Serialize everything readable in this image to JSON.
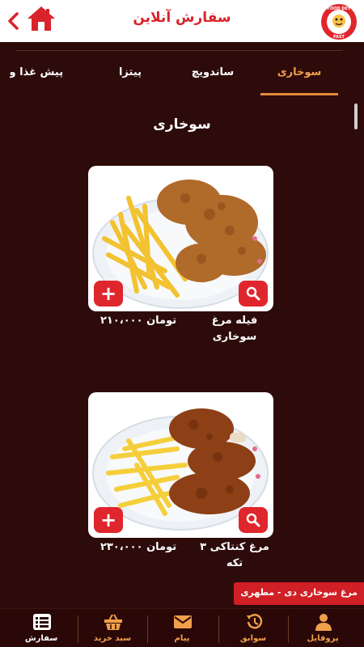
{
  "header": {
    "title": "سفارش آنلاین",
    "back_icon": "chevron-left-icon",
    "home_icon": "home-icon",
    "logo_text": "FOOD DEY FAST",
    "accent": "#d9232a"
  },
  "tabs": [
    {
      "label": "سوخاری",
      "active": true
    },
    {
      "label": "ساندویچ",
      "active": false
    },
    {
      "label": "پیتزا",
      "active": false
    },
    {
      "label": "پیش غذا و نو",
      "active": false
    }
  ],
  "section_title": "سوخاری",
  "products": [
    {
      "name_line1": "فیله مرغ",
      "name_line2": "سوخاری",
      "price": "۲۱۰،۰۰۰ تومان",
      "add_icon": "plus-icon",
      "zoom_icon": "search-icon"
    },
    {
      "name_line1": "مرغ کنتاکی ۳",
      "name_line2": "تکه",
      "price": "۲۳۰،۰۰۰ تومان",
      "add_icon": "plus-icon",
      "zoom_icon": "search-icon"
    }
  ],
  "toast": "مرغ سوخاری دی - مطهری",
  "nav": [
    {
      "label": "پروفایل",
      "icon": "user-icon"
    },
    {
      "label": "سوابق",
      "icon": "history-icon"
    },
    {
      "label": "پیام",
      "icon": "envelope-icon"
    },
    {
      "label": "سبد خرید",
      "icon": "basket-icon"
    },
    {
      "label": "سفارش",
      "icon": "list-icon",
      "active": true
    }
  ],
  "colors": {
    "background": "#2e0b0b",
    "accent_orange": "#f0a04b",
    "red": "#e0262d"
  }
}
